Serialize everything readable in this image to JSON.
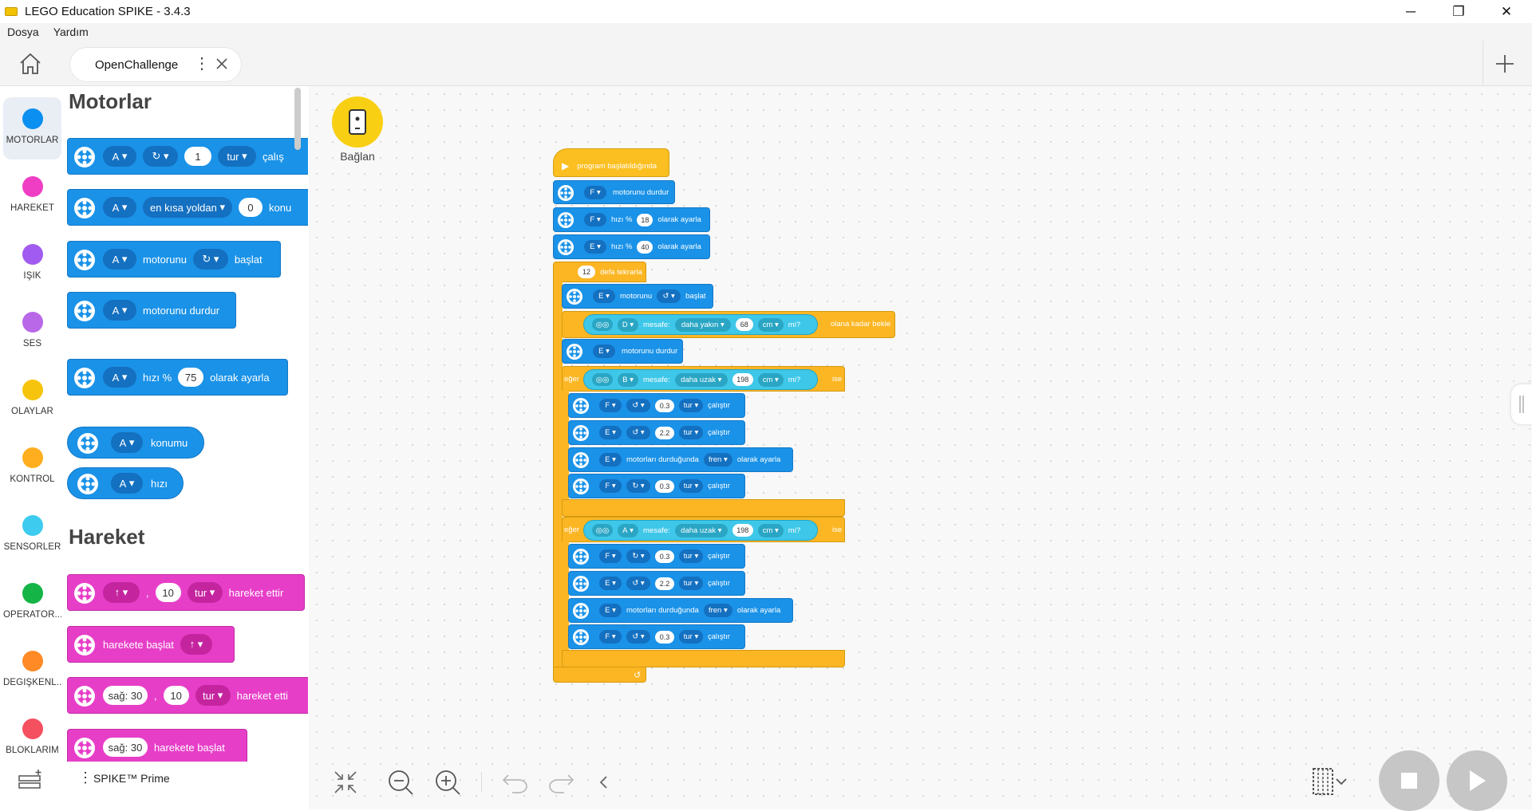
{
  "window": {
    "title": "LEGO Education SPIKE - 3.4.3",
    "minimize": "─",
    "restore": "❐",
    "close": "✕"
  },
  "menu": [
    "Dosya",
    "Yardım"
  ],
  "tab": {
    "label": "OpenChallenge"
  },
  "categories": [
    {
      "label": "MOTORLAR",
      "color": "#0b8ff0"
    },
    {
      "label": "HAREKET",
      "color": "#f03ec4"
    },
    {
      "label": "IŞIK",
      "color": "#a15bf0"
    },
    {
      "label": "SES",
      "color": "#b968e8"
    },
    {
      "label": "OLAYLAR",
      "color": "#f6c40c"
    },
    {
      "label": "KONTROL",
      "color": "#ffae1f"
    },
    {
      "label": "SENSÖRLER",
      "color": "#3dcbf0"
    },
    {
      "label": "OPERATÖR...",
      "color": "#14b546"
    },
    {
      "label": "DEĞİŞKENL...",
      "color": "#ff8a26"
    },
    {
      "label": "BLOKLARIM",
      "color": "#f45060"
    }
  ],
  "palette": {
    "motors_title": "Motorlar",
    "motion_title": "Hareket",
    "p1": {
      "port": "A",
      "val": "1",
      "unit": "tur",
      "action": "çalış"
    },
    "p2": {
      "port": "A",
      "mode": "en kısa yoldan",
      "val": "0",
      "tail": "konu"
    },
    "p3": {
      "port": "A",
      "text": "motorunu",
      "tail": "başlat"
    },
    "p4": {
      "port": "A",
      "text": "motorunu durdur"
    },
    "p5": {
      "port": "A",
      "pre": "hızı %",
      "val": "75",
      "tail": "olarak ayarla"
    },
    "p6": {
      "port": "A",
      "text": "konumu"
    },
    "p7": {
      "port": "A",
      "text": "hızı"
    },
    "h1": {
      "comma": ",",
      "val": "10",
      "unit": "tur",
      "tail": "hareket ettir"
    },
    "h2": {
      "text": "harekete başlat"
    },
    "h3": {
      "steer": "sağ: 30",
      "comma": ",",
      "val": "10",
      "unit": "tur",
      "tail": "hareket etti"
    },
    "h4": {
      "steer": "sağ: 30",
      "tail": "harekete başlat"
    },
    "hub": "SPIKE™ Prime"
  },
  "connect": {
    "label": "Bağlan"
  },
  "script": {
    "start": "program başlatıldığında",
    "s1": {
      "port": "F",
      "text": "motorunu durdur"
    },
    "s2": {
      "port": "F",
      "pre": "hızı %",
      "val": "18",
      "tail": "olarak ayarla"
    },
    "s3": {
      "port": "E",
      "pre": "hızı %",
      "val": "40",
      "tail": "olarak ayarla"
    },
    "repeat": {
      "val": "12",
      "text": "defa tekrarla"
    },
    "r1": {
      "port": "E",
      "text": "motorunu",
      "tail": "başlat"
    },
    "r2": {
      "port": "D",
      "mid": "mesafe:",
      "cmp": "daha yakın",
      "val": "68",
      "unit": "cm",
      "q": "mi?",
      "tail": "olana kadar bekle"
    },
    "r3": {
      "port": "E",
      "text": "motorunu durdur"
    },
    "if1": {
      "kw": "eğer",
      "port": "B",
      "mid": "mesafe:",
      "cmp": "daha uzak",
      "val": "198",
      "unit": "cm",
      "q": "mi?",
      "tail": "ise"
    },
    "i1": {
      "port": "F",
      "val": "0.3",
      "unit": "tur",
      "tail": "çalıştır"
    },
    "i2": {
      "port": "E",
      "val": "2.2",
      "unit": "tur",
      "tail": "çalıştır"
    },
    "i3": {
      "port": "E",
      "text": "motorları durduğunda",
      "mode": "fren",
      "tail": "olarak ayarla"
    },
    "i4": {
      "port": "F",
      "val": "0.3",
      "unit": "tur",
      "tail": "çalıştır"
    },
    "if2": {
      "kw": "eğer",
      "port": "A",
      "mid": "mesafe:",
      "cmp": "daha uzak",
      "val": "198",
      "unit": "cm",
      "q": "mi?",
      "tail": "ise"
    },
    "j1": {
      "port": "F",
      "val": "0.3",
      "unit": "tur",
      "tail": "çalıştır"
    },
    "j2": {
      "port": "E",
      "val": "2.2",
      "unit": "tur",
      "tail": "çalıştır"
    },
    "j3": {
      "port": "E",
      "text": "motorları durduğunda",
      "mode": "fren",
      "tail": "olarak ayarla"
    },
    "j4": {
      "port": "F",
      "val": "0.3",
      "unit": "tur",
      "tail": "çalıştır"
    },
    "loop": "↺"
  }
}
